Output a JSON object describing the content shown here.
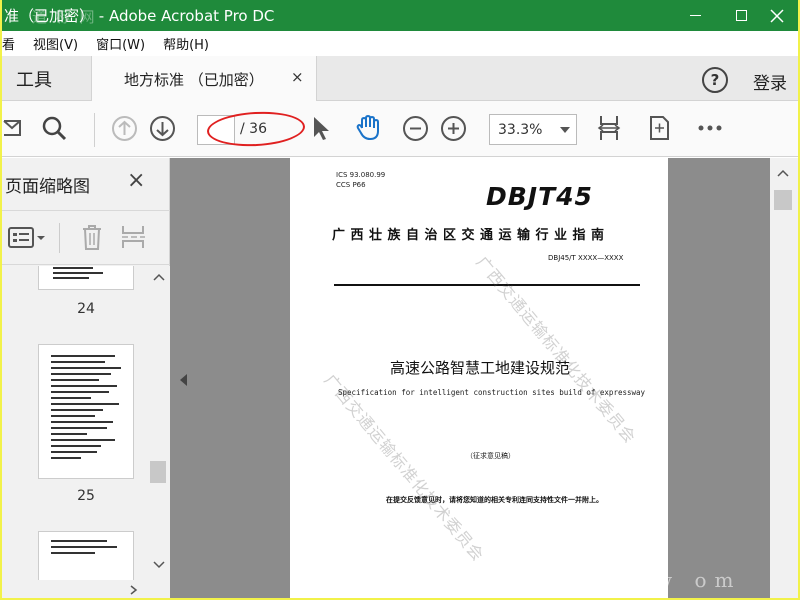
{
  "window": {
    "title": "准（已加密） - Adobe Acrobat Pro DC",
    "watermark": "道 标 网"
  },
  "menu": {
    "items": [
      "看",
      "视图(V)",
      "窗口(W)",
      "帮助(H)"
    ]
  },
  "tabs": {
    "tools_label": "工具",
    "doc_label": "地方标准 （已加密）",
    "close_glyph": "×",
    "login_label": "登录",
    "help_glyph": "?"
  },
  "toolbar": {
    "page_current": "",
    "page_total": "/ 36",
    "zoom": "33.3%"
  },
  "thumbnail_panel": {
    "title": "页面缩略图",
    "close_glyph": "×",
    "pages": [
      {
        "label": "24"
      },
      {
        "label": "25"
      },
      {
        "label": ""
      }
    ]
  },
  "document": {
    "ics": "ICS    93.080.99",
    "ccs": "CCS  P66",
    "logo": "DBJT45",
    "org": "广西壮族自治区交通运输行业指南",
    "code": "DBJ45/T XXXX—XXXX",
    "title": "高速公路智慧工地建设规范",
    "title_en": "Specification for intelligent construction sites build of expressway",
    "draft": "（征求意见稿）",
    "note": "在提交反馈意见时，请将您知道的相关专利连同支持性文件一并附上。",
    "watermark": "广西交通运输标准化技术委员会"
  },
  "site_watermark": "w    om",
  "colors": {
    "titlebar": "#1f8a3b",
    "accent_blue": "#1a73c9",
    "annotation_red": "#e02020"
  }
}
